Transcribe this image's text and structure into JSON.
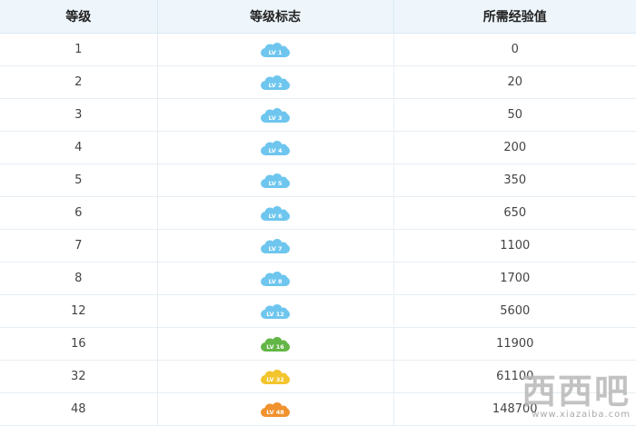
{
  "table": {
    "headers": [
      "等级",
      "等级标志",
      "所需经验值"
    ],
    "rows": [
      {
        "level": "1",
        "badge_text": "LV 1",
        "badge_color": "#6ec6ee",
        "exp": "0"
      },
      {
        "level": "2",
        "badge_text": "LV 2",
        "badge_color": "#6ec6ee",
        "exp": "20"
      },
      {
        "level": "3",
        "badge_text": "LV 3",
        "badge_color": "#6ec6ee",
        "exp": "50"
      },
      {
        "level": "4",
        "badge_text": "LV 4",
        "badge_color": "#6ec6ee",
        "exp": "200"
      },
      {
        "level": "5",
        "badge_text": "LV 5",
        "badge_color": "#6ec6ee",
        "exp": "350"
      },
      {
        "level": "6",
        "badge_text": "LV 6",
        "badge_color": "#6ec6ee",
        "exp": "650"
      },
      {
        "level": "7",
        "badge_text": "LV 7",
        "badge_color": "#6ec6ee",
        "exp": "1100"
      },
      {
        "level": "8",
        "badge_text": "LV 8",
        "badge_color": "#6ec6ee",
        "exp": "1700"
      },
      {
        "level": "12",
        "badge_text": "LV 12",
        "badge_color": "#6ec6ee",
        "exp": "5600"
      },
      {
        "level": "16",
        "badge_text": "LV 16",
        "badge_color": "#63b646",
        "exp": "11900"
      },
      {
        "level": "32",
        "badge_text": "LV 32",
        "badge_color": "#f2c52d",
        "exp": "61100"
      },
      {
        "level": "48",
        "badge_text": "LV 48",
        "badge_color": "#f0922e",
        "exp": "148700"
      }
    ]
  },
  "watermark": {
    "main": "西西吧",
    "url": "www.xiazaiba.com"
  }
}
